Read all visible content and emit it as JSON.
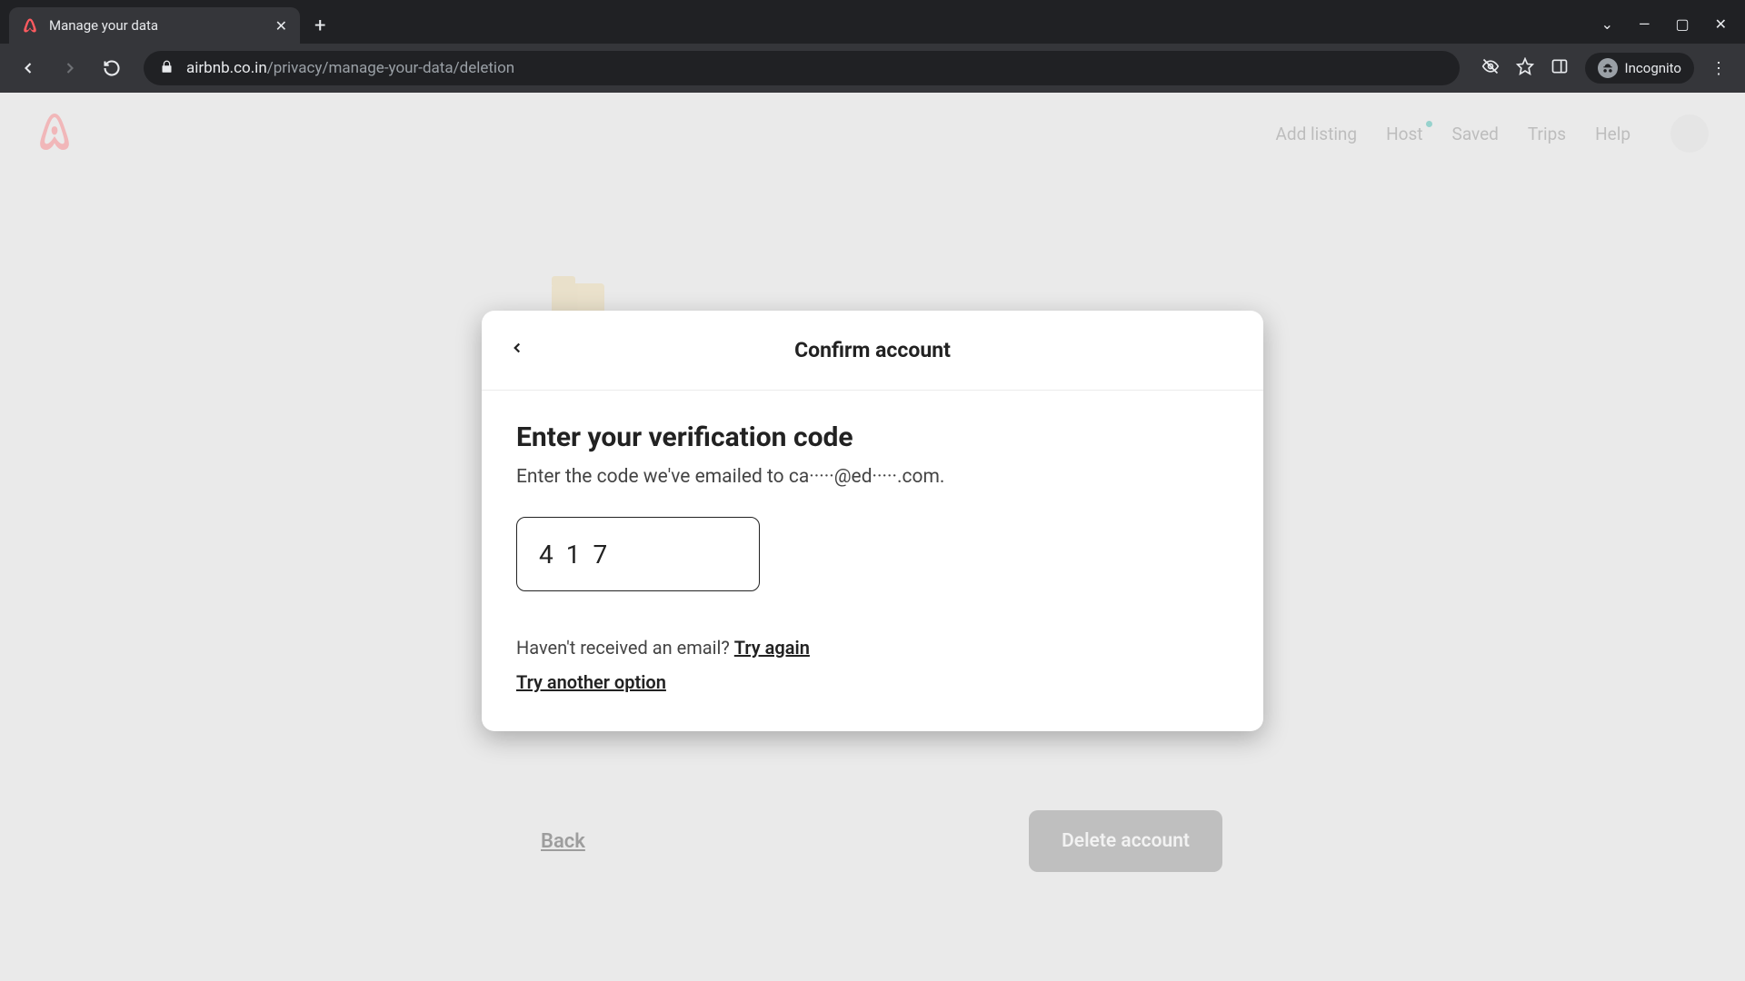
{
  "browser": {
    "tab_title": "Manage your data",
    "url_domain": "airbnb.co.in",
    "url_path": "/privacy/manage-your-data/deletion",
    "incognito_label": "Incognito"
  },
  "header": {
    "nav": {
      "add_listing": "Add listing",
      "host": "Host",
      "saved": "Saved",
      "trips": "Trips",
      "help": "Help"
    }
  },
  "background": {
    "back_label": "Back",
    "delete_label": "Delete account"
  },
  "modal": {
    "title": "Confirm account",
    "heading": "Enter your verification code",
    "instruction": "Enter the code we've emailed to ca·····@ed·····.com.",
    "code_value": "417",
    "resend_prompt": "Haven't received an email? ",
    "resend_link": "Try again",
    "another_option": "Try another option"
  }
}
